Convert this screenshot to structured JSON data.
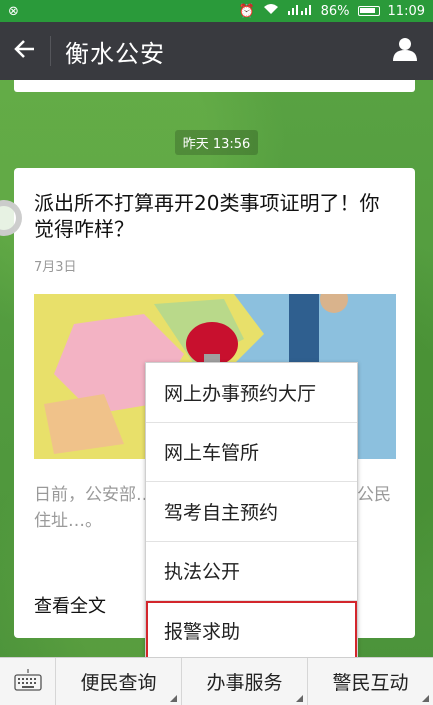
{
  "status": {
    "signal_text": "4G",
    "battery": "86%",
    "time": "11:09"
  },
  "header": {
    "title": "衡水公安"
  },
  "chat": {
    "timestamp": "昨天 13:56"
  },
  "article": {
    "title": "派出所不打算再开20类事项证明了！你觉得咋样？",
    "date": "7月3日",
    "summary": "日前，公安部…出具证明工作公开…用名、公民住址…。",
    "read_more": "查看全文"
  },
  "popup_menu": {
    "items": [
      {
        "label": "网上办事预约大厅"
      },
      {
        "label": "网上车管所"
      },
      {
        "label": "驾考自主预约"
      },
      {
        "label": "执法公开"
      },
      {
        "label": "报警求助"
      }
    ],
    "highlighted_index": 4,
    "highlight_color": "#d3262c"
  },
  "bottom_menu": {
    "tabs": [
      {
        "label": "便民查询"
      },
      {
        "label": "办事服务"
      },
      {
        "label": "警民互动"
      }
    ]
  },
  "colors": {
    "titlebar": "#393a3f",
    "statusbar": "#2a9a3a",
    "background": "#4f9a3b"
  }
}
